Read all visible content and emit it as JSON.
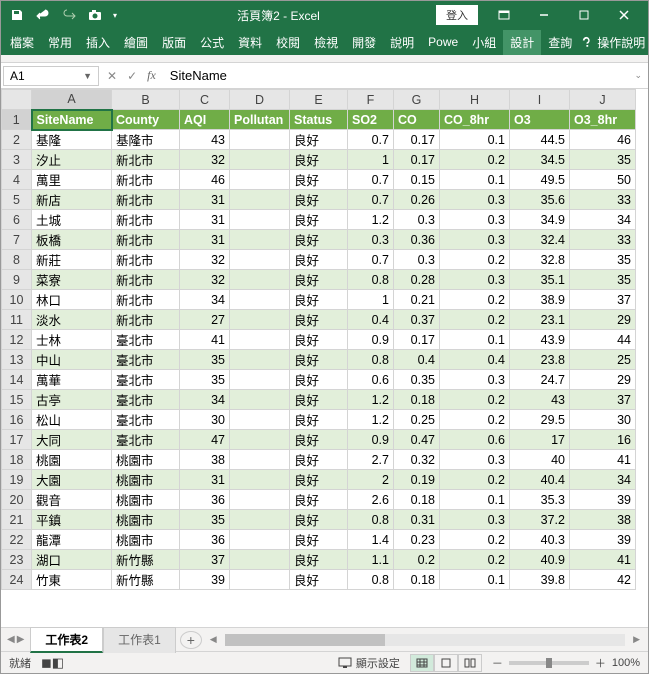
{
  "titlebar": {
    "title": "活頁簿2 - Excel",
    "login": "登入"
  },
  "ribbon": {
    "tabs": [
      "檔案",
      "常用",
      "插入",
      "繪圖",
      "版面",
      "公式",
      "資料",
      "校閱",
      "檢視",
      "開發",
      "說明",
      "Powe",
      "小組",
      "設計",
      "查詢"
    ],
    "active": 13,
    "tell": "操作說明"
  },
  "namebox": "A1",
  "formula": "SiteName",
  "columns": [
    "A",
    "B",
    "C",
    "D",
    "E",
    "F",
    "G",
    "H",
    "I",
    "J"
  ],
  "headers": [
    "SiteName",
    "County",
    "AQI",
    "Pollutan",
    "Status",
    "SO2",
    "CO",
    "CO_8hr",
    "O3",
    "O3_8hr"
  ],
  "chart_data": {
    "type": "table",
    "columns": [
      "SiteName",
      "County",
      "AQI",
      "Pollutant",
      "Status",
      "SO2",
      "CO",
      "CO_8hr",
      "O3",
      "O3_8hr"
    ],
    "rows": [
      [
        "基隆",
        "基隆市",
        43,
        "",
        "良好",
        0.7,
        0.17,
        0.1,
        44.5,
        46
      ],
      [
        "汐止",
        "新北市",
        32,
        "",
        "良好",
        1,
        0.17,
        0.2,
        34.5,
        35
      ],
      [
        "萬里",
        "新北市",
        46,
        "",
        "良好",
        0.7,
        0.15,
        0.1,
        49.5,
        50
      ],
      [
        "新店",
        "新北市",
        31,
        "",
        "良好",
        0.7,
        0.26,
        0.3,
        35.6,
        33
      ],
      [
        "土城",
        "新北市",
        31,
        "",
        "良好",
        1.2,
        0.3,
        0.3,
        34.9,
        34
      ],
      [
        "板橋",
        "新北市",
        31,
        "",
        "良好",
        0.3,
        0.36,
        0.3,
        32.4,
        33
      ],
      [
        "新莊",
        "新北市",
        32,
        "",
        "良好",
        0.7,
        0.3,
        0.2,
        32.8,
        35
      ],
      [
        "菜寮",
        "新北市",
        32,
        "",
        "良好",
        0.8,
        0.28,
        0.3,
        35.1,
        35
      ],
      [
        "林口",
        "新北市",
        34,
        "",
        "良好",
        1,
        0.21,
        0.2,
        38.9,
        37
      ],
      [
        "淡水",
        "新北市",
        27,
        "",
        "良好",
        0.4,
        0.37,
        0.2,
        23.1,
        29
      ],
      [
        "士林",
        "臺北市",
        41,
        "",
        "良好",
        0.9,
        0.17,
        0.1,
        43.9,
        44
      ],
      [
        "中山",
        "臺北市",
        35,
        "",
        "良好",
        0.8,
        0.4,
        0.4,
        23.8,
        25
      ],
      [
        "萬華",
        "臺北市",
        35,
        "",
        "良好",
        0.6,
        0.35,
        0.3,
        24.7,
        29
      ],
      [
        "古亭",
        "臺北市",
        34,
        "",
        "良好",
        1.2,
        0.18,
        0.2,
        43,
        37
      ],
      [
        "松山",
        "臺北市",
        30,
        "",
        "良好",
        1.2,
        0.25,
        0.2,
        29.5,
        30
      ],
      [
        "大同",
        "臺北市",
        47,
        "",
        "良好",
        0.9,
        0.47,
        0.6,
        17,
        16
      ],
      [
        "桃園",
        "桃園市",
        38,
        "",
        "良好",
        2.7,
        0.32,
        0.3,
        40,
        41
      ],
      [
        "大園",
        "桃園市",
        31,
        "",
        "良好",
        2,
        0.19,
        0.2,
        40.4,
        34
      ],
      [
        "觀音",
        "桃園市",
        36,
        "",
        "良好",
        2.6,
        0.18,
        0.1,
        35.3,
        39
      ],
      [
        "平鎮",
        "桃園市",
        35,
        "",
        "良好",
        0.8,
        0.31,
        0.3,
        37.2,
        38
      ],
      [
        "龍潭",
        "桃園市",
        36,
        "",
        "良好",
        1.4,
        0.23,
        0.2,
        40.3,
        39
      ],
      [
        "湖口",
        "新竹縣",
        37,
        "",
        "良好",
        1.1,
        0.2,
        0.2,
        40.9,
        41
      ],
      [
        "竹東",
        "新竹縣",
        39,
        "",
        "良好",
        0.8,
        0.18,
        0.1,
        39.8,
        42
      ]
    ]
  },
  "sheets": {
    "tabs": [
      "工作表2",
      "工作表1"
    ],
    "active": 0
  },
  "statusbar": {
    "ready": "就緒",
    "display": "顯示設定",
    "zoom": "100%"
  }
}
